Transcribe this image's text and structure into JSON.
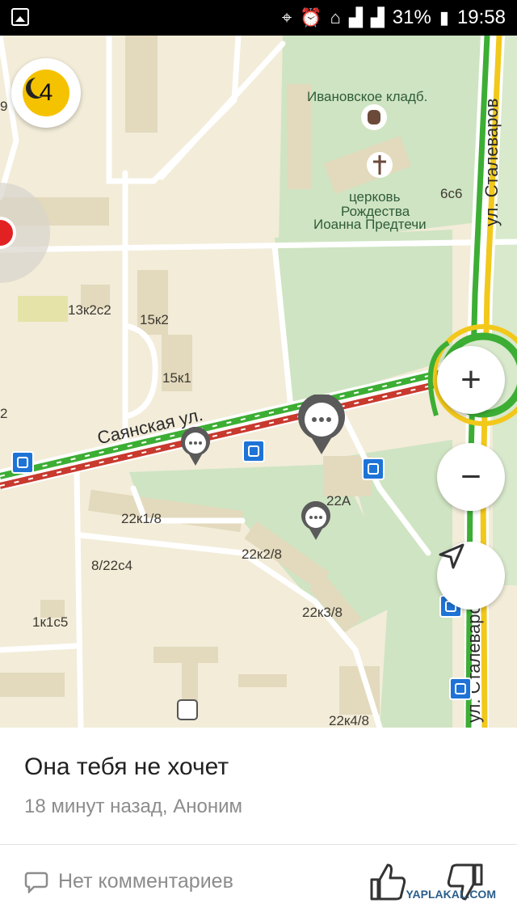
{
  "status_bar": {
    "battery": "31%",
    "time": "19:58"
  },
  "map": {
    "event_count": "4",
    "labels": {
      "cemetery": "Ивановское кладб.",
      "church_1": "церковь",
      "church_2": "Рождества",
      "church_3": "Иоанна Предтечи",
      "b_6c6": "6с6",
      "b_13k2c2": "13к2с2",
      "b_15k2": "15к2",
      "b_15k1": "15к1",
      "b_22a": "22А",
      "b_22k1_8": "22к1/8",
      "b_22k2_8": "22к2/8",
      "b_8_22c4": "8/22с4",
      "b_22k3_8": "22к3/8",
      "b_1k1c5": "1к1с5",
      "b_22k4_8": "22к4/8",
      "edge_9": "9",
      "edge_2": "2"
    },
    "roads": {
      "sayanskaya": "Саянская ул.",
      "stalevarov_top": "ул. Сталеваров",
      "stalevarov_bottom": "ул. Сталеваров"
    },
    "controls": {
      "zoom_in": "+",
      "zoom_out": "−"
    }
  },
  "event_card": {
    "title": "Она тебя не хочет",
    "meta": "18 минут назад, Аноним",
    "comments": "Нет комментариев"
  },
  "watermark": "YAPLAKAL.COM"
}
